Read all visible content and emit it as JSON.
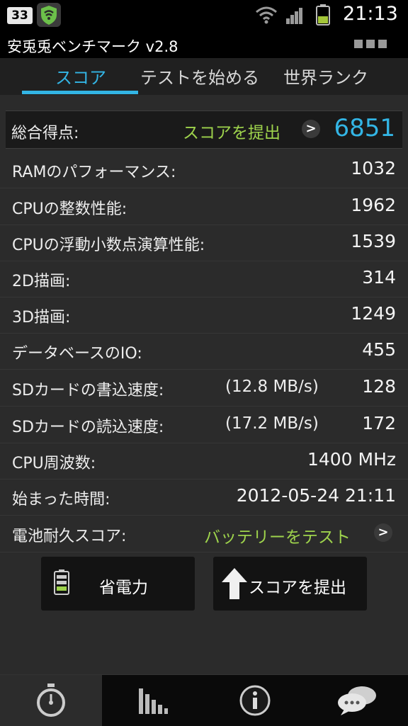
{
  "status_bar": {
    "notification_count": "33",
    "time": "21:13"
  },
  "app": {
    "title": "安兎兎ベンチマーク v2.8"
  },
  "tabs": [
    {
      "label": "スコア",
      "active": true
    },
    {
      "label": "テストを始める",
      "active": false
    },
    {
      "label": "世界ランク",
      "active": false
    }
  ],
  "total": {
    "label": "総合得点:",
    "submit_label": "スコアを提出",
    "value": "6851"
  },
  "rows": [
    {
      "label": "RAMのパフォーマンス:",
      "extra": "",
      "value": "1032"
    },
    {
      "label": "CPUの整数性能:",
      "extra": "",
      "value": "1962"
    },
    {
      "label": "CPUの浮動小数点演算性能:",
      "extra": "",
      "value": "1539"
    },
    {
      "label": "2D描画:",
      "extra": "",
      "value": "314"
    },
    {
      "label": "3D描画:",
      "extra": "",
      "value": "1249"
    },
    {
      "label": "データベースのIO:",
      "extra": "",
      "value": "455"
    },
    {
      "label": "SDカードの書込速度:",
      "extra": "(12.8 MB/s)",
      "value": "128"
    },
    {
      "label": "SDカードの読込速度:",
      "extra": "(17.2 MB/s)",
      "value": "172"
    },
    {
      "label": "CPU周波数:",
      "extra": "",
      "value": "1400 MHz"
    },
    {
      "label": "始まった時間:",
      "extra": "",
      "value": "2012-05-24 21:11"
    }
  ],
  "battery_row": {
    "label": "電池耐久スコア:",
    "link": "バッテリーをテスト"
  },
  "buttons": {
    "power_saving": "省電力",
    "submit_score": "スコアを提出"
  },
  "colors": {
    "accent": "#33b5e5",
    "link_green": "#9ed34c"
  }
}
